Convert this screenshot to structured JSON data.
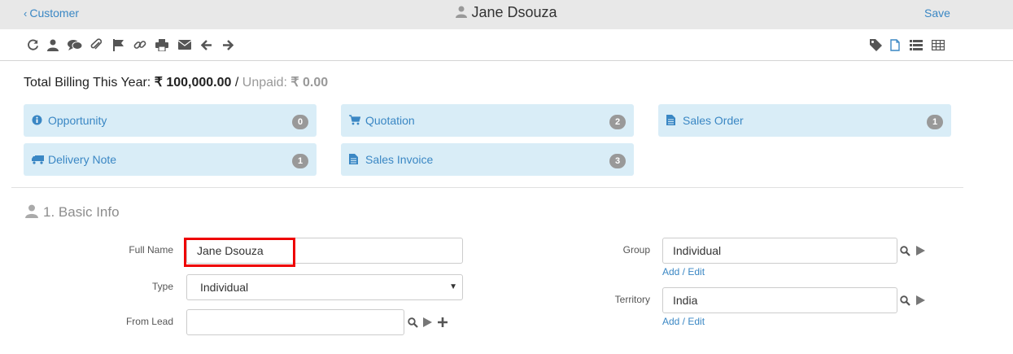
{
  "header": {
    "back_label": "Customer",
    "title": "Jane Dsouza",
    "save_label": "Save"
  },
  "toolbar": {
    "left_icons": [
      "refresh-icon",
      "user-icon",
      "comments-icon",
      "paperclip-icon",
      "flag-icon",
      "link-icon",
      "print-icon",
      "envelope-icon",
      "arrow-left-icon",
      "arrow-right-icon"
    ],
    "right_icons": [
      "tag-icon",
      "file-icon",
      "list-icon",
      "table-icon"
    ]
  },
  "billing": {
    "label": "Total Billing This Year:",
    "amount": "₹ 100,000.00",
    "sep": "/",
    "unpaid_label": "Unpaid:",
    "unpaid_amount": "₹ 0.00"
  },
  "links": [
    {
      "label": "Opportunity",
      "count": "0",
      "icon": "info-icon"
    },
    {
      "label": "Quotation",
      "count": "2",
      "icon": "cart-icon"
    },
    {
      "label": "Sales Order",
      "count": "1",
      "icon": "document-icon"
    },
    {
      "label": "Delivery Note",
      "count": "1",
      "icon": "truck-icon"
    },
    {
      "label": "Sales Invoice",
      "count": "3",
      "icon": "document-icon"
    }
  ],
  "section": {
    "title": "1. Basic Info"
  },
  "form": {
    "full_name_label": "Full Name",
    "full_name_value": "Jane Dsouza",
    "type_label": "Type",
    "type_value": "Individual",
    "from_lead_label": "From Lead",
    "from_lead_value": "",
    "group_label": "Group",
    "group_value": "Individual",
    "group_link": "Add / Edit",
    "territory_label": "Territory",
    "territory_value": "India",
    "territory_link": "Add / Edit"
  },
  "colors": {
    "accent": "#3a87c4",
    "card_bg": "#d9edf7",
    "badge": "#999999",
    "highlight": "#e00000"
  }
}
